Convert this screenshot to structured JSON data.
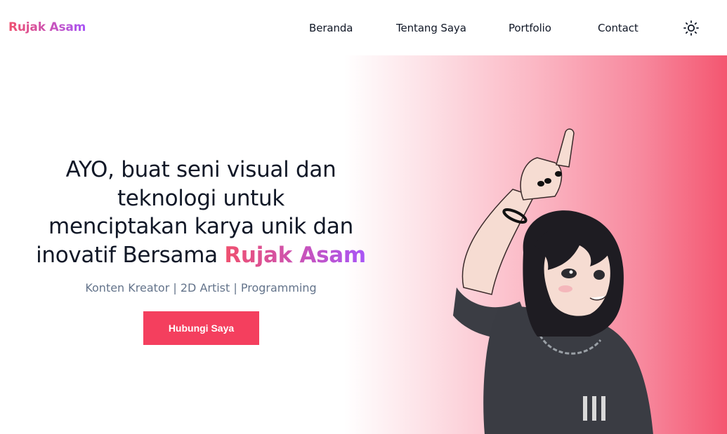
{
  "navbar": {
    "brand": "Rujak Asam",
    "links": [
      "Beranda",
      "Tentang Saya",
      "Portfolio",
      "Contact"
    ],
    "theme_toggle_icon": "sun-icon"
  },
  "hero": {
    "headline_lines": [
      "AYO, buat seni visual dan",
      "teknologi untuk",
      "menciptakan karya unik dan",
      "inovatif Bersama"
    ],
    "headline_accent": "Rujak Asam",
    "subtitle": "Konten Kreator | 2D Artist | Programming",
    "cta_label": "Hubungi Saya",
    "illustration": "anime-girl-pointing-up-illustration"
  },
  "colors": {
    "accent": "#f43f5e",
    "gradient_start": "#f0506e",
    "gradient_end": "#a855f7",
    "text_dark": "#111827",
    "text_muted": "#64748b"
  }
}
